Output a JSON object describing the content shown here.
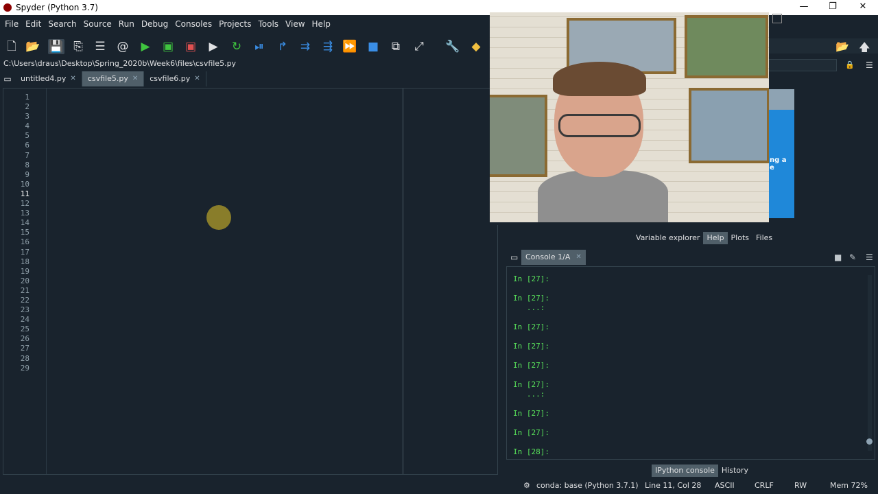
{
  "window": {
    "title": "Spyder (Python 3.7)",
    "controls": {
      "minimize": "—",
      "restore": "❐",
      "close": "✕"
    }
  },
  "menu": [
    "File",
    "Edit",
    "Search",
    "Source",
    "Run",
    "Debug",
    "Consoles",
    "Projects",
    "Tools",
    "View",
    "Help"
  ],
  "toolbar": {
    "icons": [
      "new-file-icon",
      "open-folder-icon",
      "save-icon",
      "save-all-icon",
      "outline-list-icon",
      "at-sign-icon",
      "run-icon",
      "run-cell-icon",
      "run-cell-advance-icon",
      "run-selection-icon",
      "rerun-icon",
      "debug-icon",
      "step-icon",
      "step-into-icon",
      "step-return-icon",
      "continue-icon",
      "stop-icon",
      "maximize-pane-icon",
      "fullscreen-icon",
      "preferences-icon",
      "python-path-icon"
    ],
    "colors": {
      "green": "#3fc43f",
      "blue": "#3a8ee6",
      "white": "#e0e1e3"
    }
  },
  "editor": {
    "path": "C:\\Users\\draus\\Desktop\\Spring_2020b\\Week6\\files\\csvfile5.py",
    "tabs": [
      {
        "label": "untitled4.py",
        "close": "✕",
        "active": false
      },
      {
        "label": "csvfile5.py",
        "close": "✕",
        "active": true
      },
      {
        "label": "csvfile6.py",
        "close": "✕",
        "active": false
      }
    ],
    "line_numbers": [
      "1",
      "2",
      "3",
      "4",
      "5",
      "6",
      "7",
      "8",
      "9",
      "10",
      "11",
      "12",
      "13",
      "14",
      "15",
      "16",
      "17",
      "18",
      "19",
      "20",
      "21",
      "22",
      "23",
      "24",
      "25",
      "26",
      "27",
      "28",
      "29"
    ],
    "current_line": 11
  },
  "console": {
    "tab_label": "Console 1/A",
    "tab_close": "✕",
    "lines": [
      {
        "text": "In [27]:"
      },
      {
        "text": "In [27]:"
      },
      {
        "text": "   ...:"
      },
      {
        "text": "In [27]:"
      },
      {
        "text": "In [27]:"
      },
      {
        "text": "In [27]:"
      },
      {
        "text": "In [27]:"
      },
      {
        "text": "   ...:"
      },
      {
        "text": "In [27]:"
      },
      {
        "text": "In [27]:"
      },
      {
        "text": "In [28]:"
      }
    ]
  },
  "pane_tabs": [
    {
      "label": "Variable explorer",
      "active": false
    },
    {
      "label": "Help",
      "active": true
    },
    {
      "label": "Plots",
      "active": false
    },
    {
      "label": "Files",
      "active": false
    }
  ],
  "bottom_tabs": [
    {
      "label": "IPython console",
      "active": true
    },
    {
      "label": "History",
      "active": false
    }
  ],
  "help_panel": {
    "fragment_line1": "ng a",
    "fragment_line2": "e"
  },
  "status": {
    "env": "conda: base (Python 3.7.1)",
    "position": "Line 11, Col 28",
    "encoding": "ASCII",
    "eol": "CRLF",
    "permissions": "RW",
    "memory": "Mem 72%"
  }
}
